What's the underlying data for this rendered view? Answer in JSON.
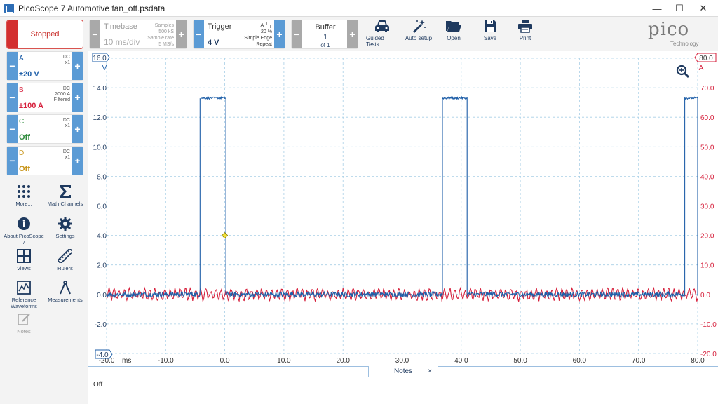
{
  "window": {
    "title": "PicoScope 7 Automotive fan_off.psdata",
    "minimize": "—",
    "maximize": "☐",
    "close": "✕"
  },
  "toolbar": {
    "stopped_label": "Stopped",
    "timebase": {
      "label": "Timebase",
      "value": "10 ms/div",
      "samples_label": "Samples",
      "samples_value": "500 kS",
      "rate_label": "Sample rate",
      "rate_value": "5 MS/s"
    },
    "trigger": {
      "label": "Trigger",
      "channel": "A",
      "edge_symbol": "┘┐",
      "percent": "20 %",
      "type": "Simple Edge",
      "mode": "Repeat",
      "value": "4 V"
    },
    "buffer": {
      "label": "Buffer",
      "current": "1",
      "total": "of 1"
    },
    "tools": [
      {
        "name": "guided-tests",
        "label": "Guided Tests",
        "icon": "car-icon"
      },
      {
        "name": "auto-setup",
        "label": "Auto setup",
        "icon": "wand-icon"
      },
      {
        "name": "open",
        "label": "Open",
        "icon": "folder-icon"
      },
      {
        "name": "save",
        "label": "Save",
        "icon": "floppy-icon"
      },
      {
        "name": "print",
        "label": "Print",
        "icon": "printer-icon"
      }
    ],
    "logo": {
      "word": "pico",
      "sub": "Technology"
    }
  },
  "channels": [
    {
      "name": "A",
      "coupling": "DC",
      "probe": "x1",
      "extra": "",
      "range": "±20 V",
      "color": "#1f5fa8"
    },
    {
      "name": "B",
      "coupling": "DC",
      "probe": "2000 A",
      "extra": "Filtered",
      "range": "±100 A",
      "color": "#d6203c"
    },
    {
      "name": "C",
      "coupling": "DC",
      "probe": "x1",
      "extra": "",
      "range": "Off",
      "color": "#2e8b3c"
    },
    {
      "name": "D",
      "coupling": "DC",
      "probe": "x1",
      "extra": "",
      "range": "Off",
      "color": "#c8951a"
    }
  ],
  "left_buttons": [
    {
      "name": "more",
      "label": "More...",
      "icon": "dots-grid-icon"
    },
    {
      "name": "math-channels",
      "label": "Math Channels",
      "icon": "sigma-icon"
    },
    {
      "name": "about",
      "label": "About PicoScope 7",
      "icon": "info-icon"
    },
    {
      "name": "settings",
      "label": "Settings",
      "icon": "gear-icon"
    },
    {
      "name": "views",
      "label": "Views",
      "icon": "grid-icon"
    },
    {
      "name": "rulers",
      "label": "Rulers",
      "icon": "ruler-icon"
    },
    {
      "name": "reference-waveforms",
      "label": "Reference Waveforms",
      "icon": "waveform-icon"
    },
    {
      "name": "measurements",
      "label": "Measurements",
      "icon": "caliper-icon"
    },
    {
      "name": "notes",
      "label": "Notes",
      "icon": "note-icon"
    }
  ],
  "notes": {
    "tab_label": "Notes",
    "close": "×",
    "text": "Off"
  },
  "chart_data": {
    "type": "line",
    "x_unit": "ms",
    "xlim": [
      -20,
      80
    ],
    "x_ticks": [
      "-20.0",
      "-10.0",
      "0.0",
      "10.0",
      "20.0",
      "30.0",
      "40.0",
      "50.0",
      "60.0",
      "70.0",
      "80.0"
    ],
    "left_axis": {
      "unit": "V",
      "ylim": [
        -4,
        16
      ],
      "top_label": "16.0",
      "bottom_label": "-4.0",
      "ticks": [
        "14.0",
        "12.0",
        "10.0",
        "8.0",
        "6.0",
        "4.0",
        "2.0",
        "0.0",
        "-2.0"
      ],
      "color": "#1f5fa8"
    },
    "right_axis": {
      "unit": "A",
      "ylim": [
        -20,
        80
      ],
      "top_label": "80.0",
      "ticks": [
        "70.0",
        "60.0",
        "50.0",
        "40.0",
        "30.0",
        "20.0",
        "10.0",
        "0.0",
        "-10.0",
        "-20.0"
      ],
      "color": "#d6203c"
    },
    "grid": true,
    "trigger_marker": {
      "x": 0,
      "y": 4
    },
    "series": [
      {
        "name": "A",
        "axis": "left",
        "color": "#1f5fa8",
        "pulses": [
          [
            -4.2,
            0.1
          ],
          [
            36.8,
            41
          ],
          [
            77.8,
            80
          ]
        ],
        "high": 13.3,
        "low": 0,
        "noise": 0.35
      },
      {
        "name": "B",
        "axis": "right",
        "color": "#d6203c",
        "baseline": 0,
        "amplitude": 1.6,
        "noise": 0.8
      }
    ]
  }
}
